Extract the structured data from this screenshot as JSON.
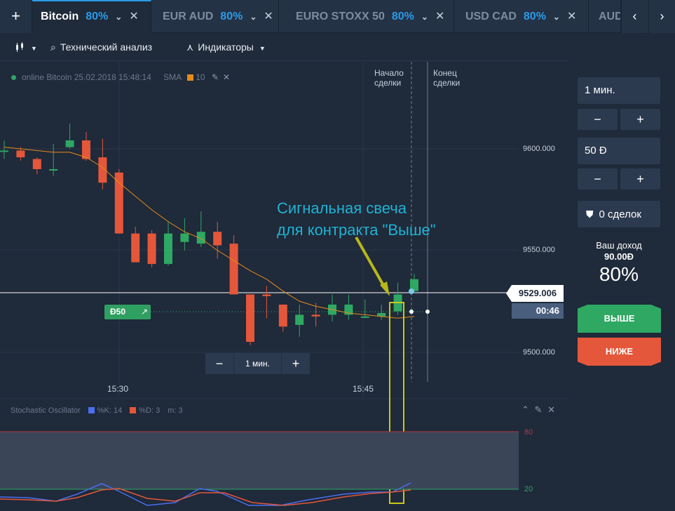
{
  "tabs": [
    {
      "name": "Bitcoin",
      "pct": "80%",
      "active": true
    },
    {
      "name": "EUR AUD",
      "pct": "80%"
    },
    {
      "name": "EURO STOXX 50",
      "pct": "80%"
    },
    {
      "name": "USD CAD",
      "pct": "80%"
    },
    {
      "name": "AUD"
    }
  ],
  "toolbar": {
    "tech_analysis": "Технический анализ",
    "indicators": "Индикаторы"
  },
  "chart_info": {
    "text": "online Bitcoin  25.02.2018 15:48:14",
    "sma_label": "SMA",
    "sma_period": "10"
  },
  "price_axis": [
    "9600.000",
    "9550.000",
    "9500.000"
  ],
  "time_axis": [
    "15:30",
    "15:45"
  ],
  "trade_markers": {
    "start": "Начало\nсделки",
    "end": "Конец\nсделки"
  },
  "current_price": "9529.006",
  "timer": "00:46",
  "bet_badge": "Ð50",
  "timeframe": {
    "value": "1 мин.",
    "minus": "−",
    "plus": "+"
  },
  "annotation": [
    "Сигнальная свеча",
    "для контракта \"Выше\""
  ],
  "oscillator": {
    "name": "Stochastic Oscillator",
    "k_label": "%K: 14",
    "d_label": "%D: 3",
    "m_label": "m: 3",
    "level_high": "80",
    "level_low": "20"
  },
  "panel": {
    "time_value": "1 мин.",
    "amount_value": "50 Ð",
    "minus": "−",
    "plus": "+",
    "deals": "0 сделок",
    "income_title": "Ваш доход",
    "income_amount": "90.00Ð",
    "income_pct": "80%",
    "up_label": "ВЫШЕ",
    "down_label": "НИЖЕ"
  },
  "colors": {
    "accent": "#2a9be8",
    "up": "#2ea863",
    "down": "#e4573a",
    "sma": "#e68a1c",
    "annotation": "#1fb3d3",
    "highlight": "#c8c81a"
  },
  "chart_data": {
    "type": "candlestick",
    "instrument": "Bitcoin",
    "ylim": [
      9475,
      9645
    ],
    "candles": [
      {
        "o": 9605,
        "c": 9605,
        "h": 9611,
        "l": 9600
      },
      {
        "o": 9605,
        "c": 9601,
        "h": 9607,
        "l": 9599
      },
      {
        "o": 9600,
        "c": 9594,
        "h": 9601,
        "l": 9591
      },
      {
        "o": 9594,
        "c": 9594,
        "h": 9609,
        "l": 9590
      },
      {
        "o": 9607,
        "c": 9611,
        "h": 9621,
        "l": 9606
      },
      {
        "o": 9611,
        "c": 9600,
        "h": 9616,
        "l": 9599
      },
      {
        "o": 9601,
        "c": 9586,
        "h": 9612,
        "l": 9582
      },
      {
        "o": 9592,
        "c": 9556,
        "h": 9594,
        "l": 9556
      },
      {
        "o": 9556,
        "c": 9539,
        "h": 9560,
        "l": 9539
      },
      {
        "o": 9556,
        "c": 9538,
        "h": 9558,
        "l": 9536
      },
      {
        "o": 9538,
        "c": 9556,
        "h": 9563,
        "l": 9537
      },
      {
        "o": 9551,
        "c": 9556,
        "h": 9565,
        "l": 9546
      },
      {
        "o": 9550,
        "c": 9557,
        "h": 9569,
        "l": 9548
      },
      {
        "o": 9557,
        "c": 9549,
        "h": 9563,
        "l": 9541
      },
      {
        "o": 9550,
        "c": 9520,
        "h": 9555,
        "l": 9520
      },
      {
        "o": 9520,
        "c": 9492,
        "h": 9515,
        "l": 9490
      },
      {
        "o": 9520,
        "c": 9519,
        "h": 9525,
        "l": 9506
      },
      {
        "o": 9514,
        "c": 9501,
        "h": 9514,
        "l": 9498
      },
      {
        "o": 9502,
        "c": 9508,
        "h": 9514,
        "l": 9495
      },
      {
        "o": 9508,
        "c": 9507,
        "h": 9515,
        "l": 9501
      },
      {
        "o": 9508,
        "c": 9514,
        "h": 9520,
        "l": 9504
      },
      {
        "o": 9508,
        "c": 9514,
        "h": 9520,
        "l": 9505
      },
      {
        "o": 9507,
        "c": 9507,
        "h": 9517,
        "l": 9506
      },
      {
        "o": 9507,
        "c": 9509,
        "h": 9514,
        "l": 9505
      },
      {
        "o": 9510,
        "c": 9520,
        "h": 9527,
        "l": 9508
      },
      {
        "o": 9522,
        "c": 9529,
        "h": 9532,
        "l": 9521
      }
    ],
    "sma": [
      9607,
      9606,
      9605,
      9604,
      9604,
      9601,
      9595,
      9586,
      9578,
      9570,
      9563,
      9557,
      9553,
      9546,
      9540,
      9534,
      9529,
      9522,
      9516,
      9513,
      9511,
      9509,
      9508,
      9507,
      9506,
      9507
    ]
  }
}
